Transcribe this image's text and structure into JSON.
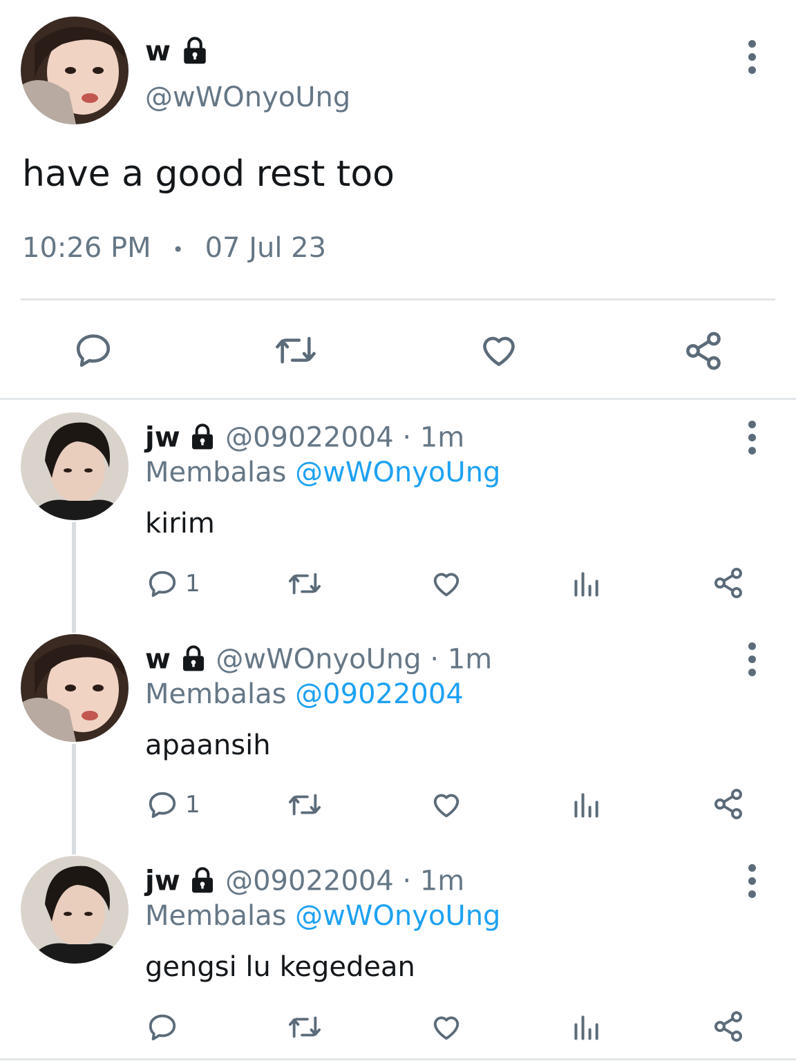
{
  "main_tweet": {
    "display_name": "w",
    "handle": "@wWOnyoUng",
    "text": "have a good rest too",
    "time": "10:26 PM",
    "separator": "•",
    "date": "07 Jul 23"
  },
  "replies": [
    {
      "display_name": "jw",
      "handle": "@09022004",
      "time": "· 1m",
      "replying_label": "Membalas",
      "replying_to": "@wWOnyoUng",
      "text": "kirim",
      "reply_count": "1"
    },
    {
      "display_name": "w",
      "handle": "@wWOnyoUng",
      "time": "· 1m",
      "replying_label": "Membalas",
      "replying_to": "@09022004",
      "text": "apaansih",
      "reply_count": "1"
    },
    {
      "display_name": "jw",
      "handle": "@09022004",
      "time": "· 1m",
      "replying_label": "Membalas",
      "replying_to": "@wWOnyoUng",
      "text": "gengsi lu kegedean",
      "reply_count": ""
    }
  ],
  "icons": {
    "lock": "lock-icon",
    "reply": "reply-icon",
    "retweet": "retweet-icon",
    "like": "heart-icon",
    "analytics": "analytics-icon",
    "share": "share-icon",
    "more": "more-vertical-icon"
  },
  "colors": {
    "link": "#1da1f2",
    "secondary_text": "#657786",
    "icon": "#5b6b79"
  }
}
